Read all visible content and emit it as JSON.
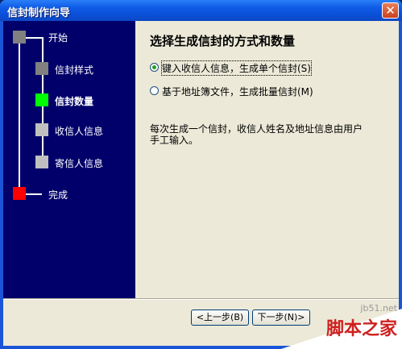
{
  "window": {
    "title": "信封制作向导",
    "close_label": "✕"
  },
  "steps": [
    {
      "label": "开始",
      "color": "#808080",
      "current": false
    },
    {
      "label": "信封样式",
      "color": "#808080",
      "current": false
    },
    {
      "label": "信封数量",
      "color": "#00ff00",
      "current": true
    },
    {
      "label": "收信人信息",
      "color": "#c0c0c0",
      "current": false
    },
    {
      "label": "寄信人信息",
      "color": "#c0c0c0",
      "current": false
    },
    {
      "label": "完成",
      "color": "#ff0000",
      "current": false
    }
  ],
  "main": {
    "heading": "选择生成信封的方式和数量",
    "options": [
      {
        "label": "键入收信人信息，生成单个信封(S)",
        "checked": true
      },
      {
        "label": "基于地址簿文件，生成批量信封(M)",
        "checked": false
      }
    ],
    "description": "每次生成一个信封，收信人姓名及地址信息由用户手工输入。"
  },
  "footer": {
    "back_label": "<上一步(B)",
    "next_label": "下一步(N)>"
  },
  "watermark": {
    "site": "jb51.net",
    "name": "脚本之家"
  }
}
